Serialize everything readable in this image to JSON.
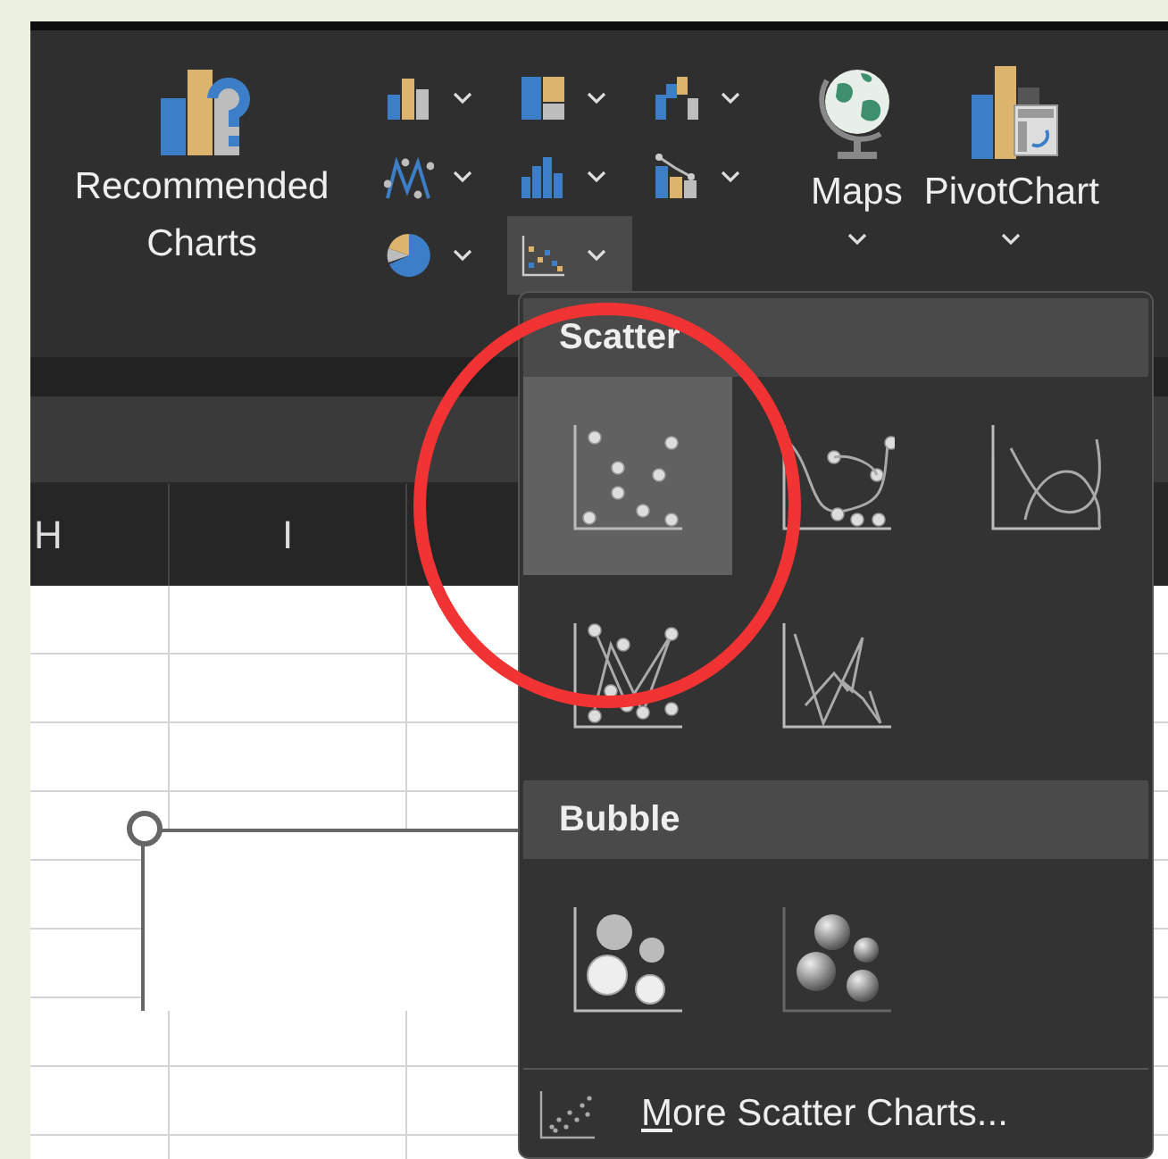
{
  "ribbon": {
    "recommended": {
      "label": "Recommended Charts"
    },
    "chart_buttons": [
      {
        "kind": "column",
        "selected": false
      },
      {
        "kind": "treemap",
        "selected": false
      },
      {
        "kind": "waterfall",
        "selected": false
      },
      {
        "kind": "line",
        "selected": false
      },
      {
        "kind": "histogram",
        "selected": false
      },
      {
        "kind": "combo",
        "selected": false
      },
      {
        "kind": "pie",
        "selected": false
      },
      {
        "kind": "scatter",
        "selected": true
      }
    ],
    "maps": {
      "label": "Maps"
    },
    "pivotchart": {
      "label": "PivotChart"
    }
  },
  "sheet": {
    "columns": [
      "H",
      "I"
    ]
  },
  "menu": {
    "sections": [
      {
        "title": "Scatter",
        "items": [
          {
            "kind": "markers",
            "selected": true
          },
          {
            "kind": "smooth_markers",
            "selected": false
          },
          {
            "kind": "smooth_lines",
            "selected": false
          },
          {
            "kind": "straight_markers",
            "selected": false
          },
          {
            "kind": "straight_lines",
            "selected": false
          }
        ]
      },
      {
        "title": "Bubble",
        "items": [
          {
            "kind": "bubble",
            "selected": false
          },
          {
            "kind": "bubble_3d",
            "selected": false
          }
        ]
      }
    ],
    "footer": {
      "label": "More Scatter Charts..."
    }
  },
  "annotation": {
    "kind": "circle"
  }
}
